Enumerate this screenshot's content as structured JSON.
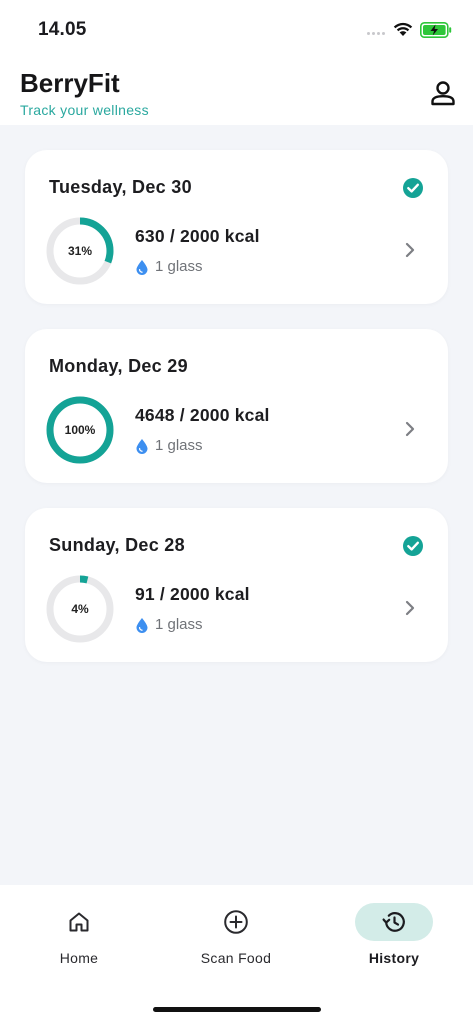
{
  "status_bar": {
    "time": "14.05"
  },
  "header": {
    "title": "BerryFit",
    "subtitle": "Track your wellness"
  },
  "history": [
    {
      "date": "Tuesday, Dec 30",
      "percent_label": "31%",
      "progress": 0.31,
      "kcal": "630 / 2000 kcal",
      "water": "1 glass",
      "completed": true
    },
    {
      "date": "Monday, Dec 29",
      "percent_label": "100%",
      "progress": 1.0,
      "kcal": "4648 / 2000 kcal",
      "water": "1 glass",
      "completed": false
    },
    {
      "date": "Sunday, Dec 28",
      "percent_label": "4%",
      "progress": 0.04,
      "kcal": "91 / 2000 kcal",
      "water": "1 glass",
      "completed": true
    }
  ],
  "nav": {
    "home": "Home",
    "scan": "Scan Food",
    "history": "History",
    "active": "history"
  },
  "colors": {
    "accent": "#14a396",
    "track": "#e8e8ea",
    "water": "#3d8ff0"
  }
}
